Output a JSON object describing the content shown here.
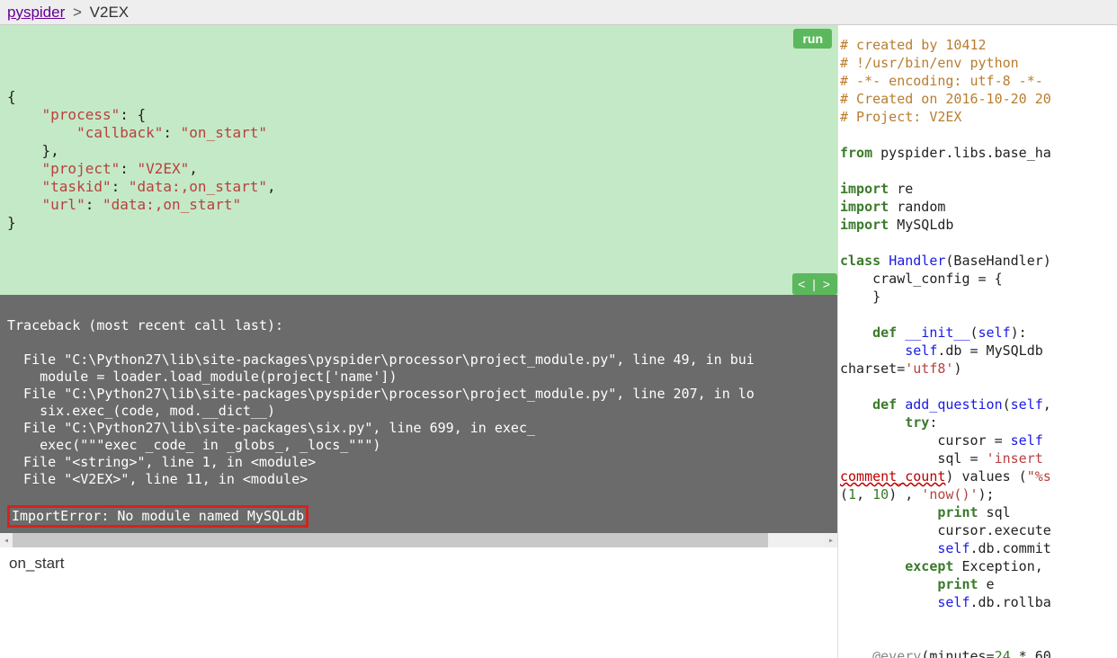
{
  "topbar": {
    "home_link": "pyspider",
    "sep": ">",
    "project": "V2EX"
  },
  "buttons": {
    "run": "run",
    "nav": "< | >"
  },
  "json_panel": {
    "raw": "{\n    \"process\": {\n        \"callback\": \"on_start\"\n    },\n    \"project\": \"V2EX\",\n    \"taskid\": \"data:,on_start\",\n    \"url\": \"data:,on_start\"\n}",
    "data": {
      "process": {
        "callback": "on_start"
      },
      "project": "V2EX",
      "taskid": "data:,on_start",
      "url": "data:,on_start"
    }
  },
  "traceback": {
    "header": "Traceback (most recent call last):",
    "lines": [
      "  File \"C:\\Python27\\lib\\site-packages\\pyspider\\processor\\project_module.py\", line 49, in bui",
      "    module = loader.load_module(project['name'])",
      "  File \"C:\\Python27\\lib\\site-packages\\pyspider\\processor\\project_module.py\", line 207, in lo",
      "    six.exec_(code, mod.__dict__)",
      "  File \"C:\\Python27\\lib\\site-packages\\six.py\", line 699, in exec_",
      "    exec(\"\"\"exec _code_ in _globs_, _locs_\"\"\")",
      "  File \"<string>\", line 1, in <module>",
      "  File \"<V2EX>\", line 11, in <module>"
    ],
    "error": "ImportError: No module named MySQLdb"
  },
  "bottom_left": {
    "text": "on_start"
  },
  "source": {
    "lines": [
      {
        "cls": "c-cmt",
        "t": "# created by 10412"
      },
      {
        "cls": "c-cmt",
        "t": "# !/usr/bin/env python"
      },
      {
        "cls": "c-cmt",
        "t": "# -*- encoding: utf-8 -*-"
      },
      {
        "cls": "c-cmt",
        "t": "# Created on 2016-10-20 20"
      },
      {
        "cls": "c-cmt",
        "t": "# Project: V2EX"
      },
      {
        "cls": "",
        "t": ""
      },
      {
        "html": "<span class='c-kw'>from</span> pyspider.libs.base_ha"
      },
      {
        "cls": "",
        "t": ""
      },
      {
        "html": "<span class='c-kw'>import</span> re"
      },
      {
        "html": "<span class='c-kw'>import</span> random"
      },
      {
        "html": "<span class='c-kw'>import</span> MySQLdb"
      },
      {
        "cls": "",
        "t": ""
      },
      {
        "html": "<span class='c-kw'>class</span> <span class='c-blue'>Handler</span>(BaseHandler)"
      },
      {
        "html": "    crawl_config = {"
      },
      {
        "html": "    }"
      },
      {
        "cls": "",
        "t": ""
      },
      {
        "html": "    <span class='c-kw'>def</span> <span class='c-blue'>__init__</span>(<span class='c-self'>self</span>):"
      },
      {
        "html": "        <span class='c-self'>self</span>.db = MySQLdb"
      },
      {
        "html": "charset=<span class='c-str'>'utf8'</span>)"
      },
      {
        "cls": "",
        "t": ""
      },
      {
        "html": "    <span class='c-kw'>def</span> <span class='c-blue'>add_question</span>(<span class='c-self'>self</span>,"
      },
      {
        "html": "        <span class='c-kw'>try</span>:"
      },
      {
        "html": "            cursor = <span class='c-self'>self</span>"
      },
      {
        "html": "            sql = <span class='c-str'>'insert </span>"
      },
      {
        "html": "<span class='c-err'>comment_count</span>) values (<span class='c-str'>\"%s</span>"
      },
      {
        "html": "(<span class='c-num'>1</span>, <span class='c-num'>10</span>) , <span class='c-str'>'now()'</span>);"
      },
      {
        "html": "            <span class='c-kw'>print</span> sql"
      },
      {
        "html": "            cursor.execute"
      },
      {
        "html": "            <span class='c-self'>self</span>.db.commit"
      },
      {
        "html": "        <span class='c-kw'>except</span> Exception,"
      },
      {
        "html": "            <span class='c-kw'>print</span> e"
      },
      {
        "html": "            <span class='c-self'>self</span>.db.rollba"
      },
      {
        "cls": "",
        "t": ""
      },
      {
        "cls": "",
        "t": ""
      },
      {
        "html": "    <span class='c-dec'>@every</span>(minutes=<span class='c-num'>24</span> * 60"
      }
    ]
  }
}
